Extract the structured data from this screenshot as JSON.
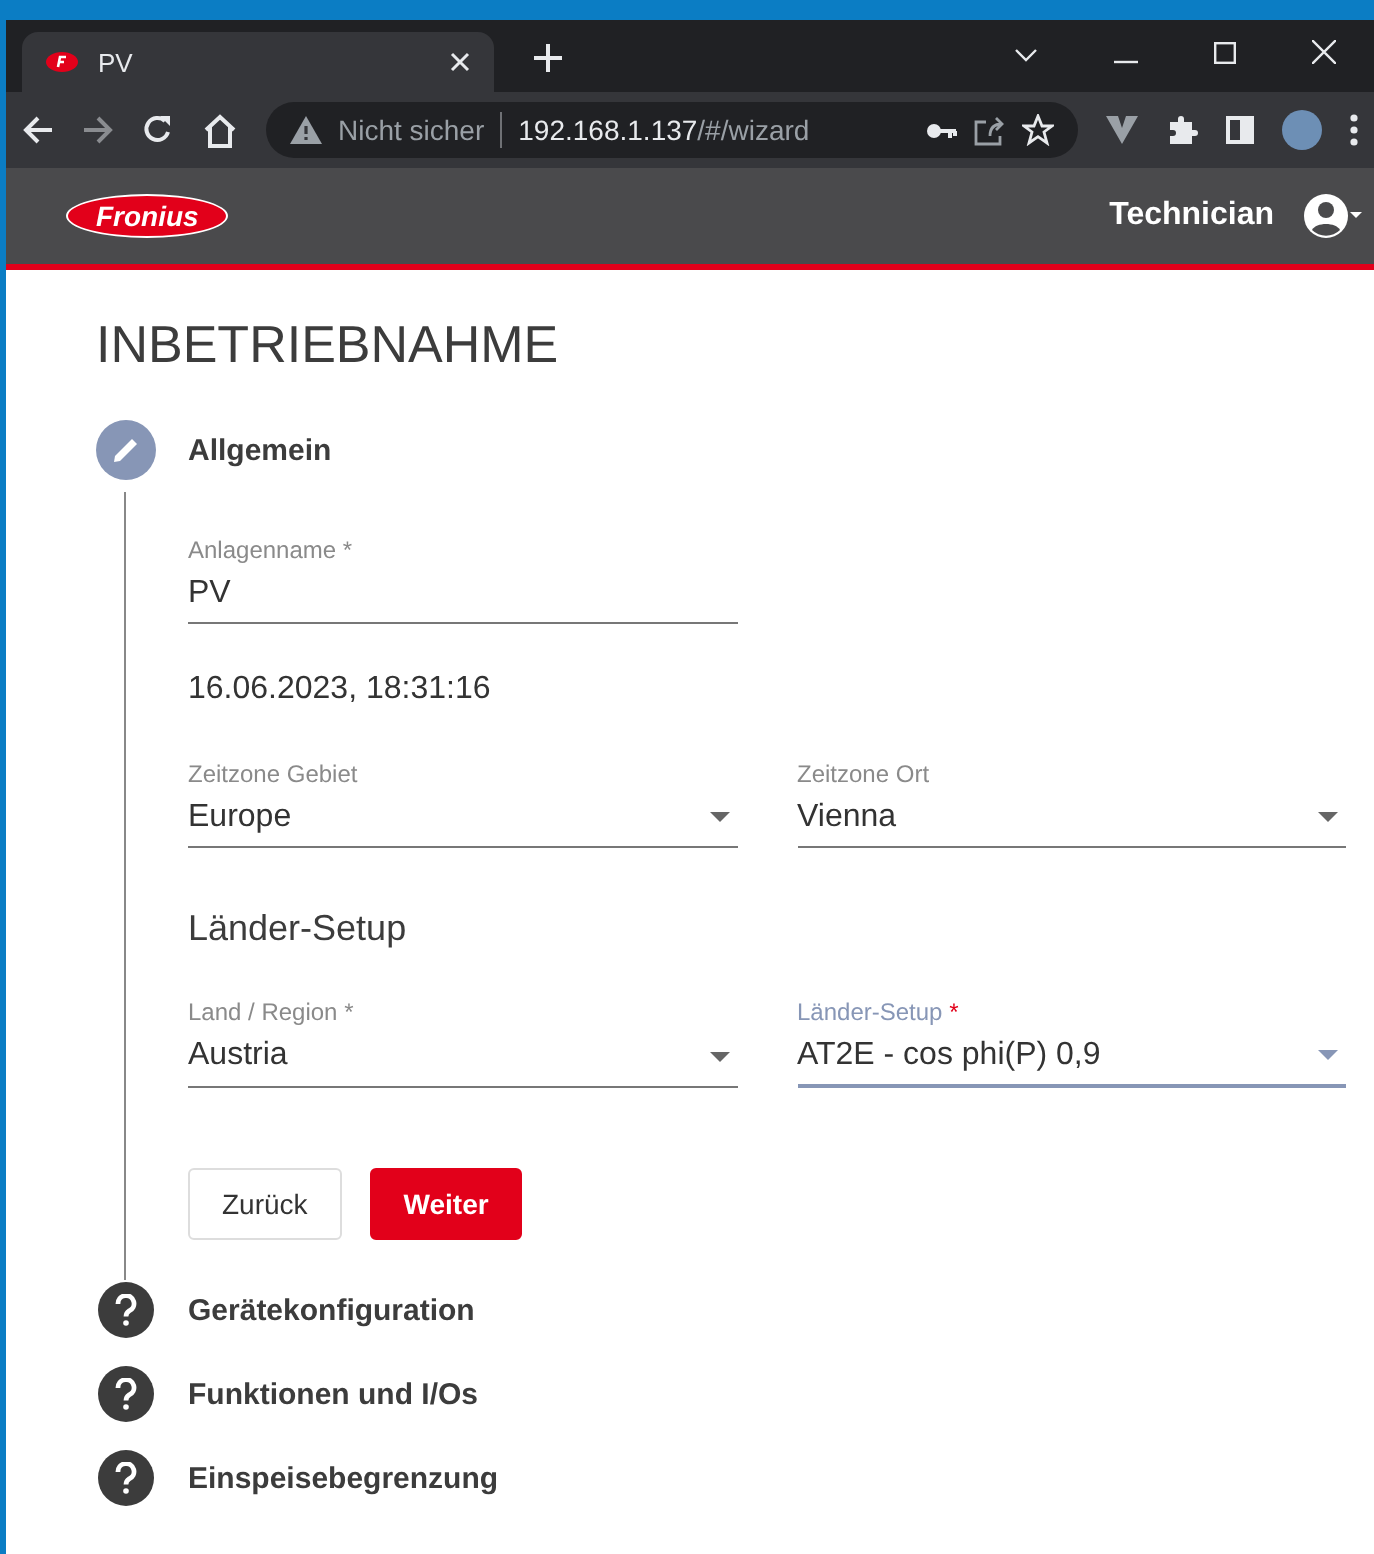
{
  "browser": {
    "tab": {
      "title": "PV",
      "selected": true
    },
    "address": {
      "security": "Nicht sicher",
      "host": "192.168.1.137",
      "path": "/#/wizard"
    }
  },
  "header": {
    "logo": "Fronius",
    "user": "Technician"
  },
  "page": {
    "title": "INBETRIEBNAHME"
  },
  "steps": [
    {
      "title": "Allgemein",
      "active": true,
      "content": {
        "name_field": {
          "label": "Anlagenname",
          "asterisk": "*",
          "value": "PV"
        },
        "datetime": "16.06.2023, 18:31:16",
        "timezone": [
          {
            "label": "Zeitzone Gebiet",
            "value": "Europe",
            "focused": false
          },
          {
            "label": "Zeitzone Ort",
            "value": "Vienna",
            "focused": false
          }
        ],
        "section": "Länder-Setup",
        "country": [
          {
            "label": "Land / Region",
            "asterisk": "*",
            "value": "Austria",
            "focused": false
          },
          {
            "label": "Länder-Setup",
            "asterisk": "*",
            "value": "AT2E - cos phi(P) 0,9",
            "focused": true
          }
        ],
        "buttons": [
          {
            "label": "Zurück",
            "kind": "secondary"
          },
          {
            "label": "Weiter",
            "kind": "primary"
          }
        ]
      }
    },
    {
      "title": "Gerätekonfiguration",
      "active": false
    },
    {
      "title": "Funktionen und I/Os",
      "active": false
    },
    {
      "title": "Einspeisebegrenzung",
      "active": false
    }
  ]
}
